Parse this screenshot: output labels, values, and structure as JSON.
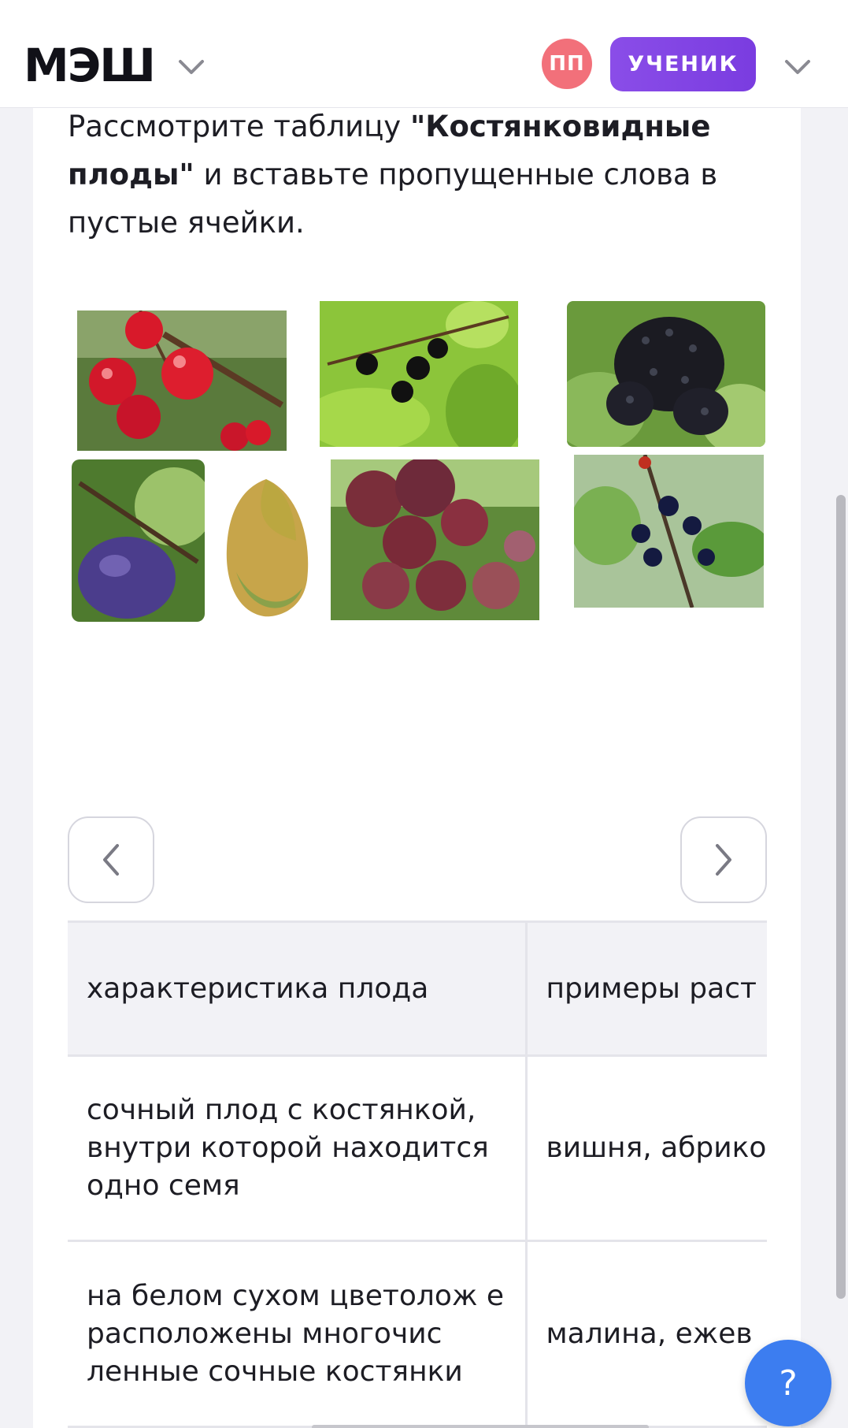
{
  "header": {
    "logo": "МЭШ",
    "avatar_initials": "ПП",
    "role_label": "УЧЕНИК"
  },
  "question": {
    "before": "Рассмотрите таблицу ",
    "bold": "\"Костянковидные плоды\"",
    "after": " и вставьте пропущенные слова в пустые ячейки."
  },
  "gallery": {
    "photos": [
      "cherry-photo",
      "bird-cherry-photo",
      "elderberry-photo",
      "plum-photo",
      "mango-photo",
      "cherry-plum-photo",
      "buckthorn-photo"
    ],
    "prev_icon": "chevron-left-icon",
    "next_icon": "chevron-right-icon"
  },
  "table": {
    "headers": [
      "характеристика плода",
      "примеры раст"
    ],
    "rows": [
      [
        "сочный плод с костянкой, внутри которой находится одно семя",
        "вишня, абрико"
      ],
      [
        "на белом сухом цветолож е расположены многочис ленные сочные костянки",
        "малина, ежев"
      ]
    ]
  },
  "help": {
    "label": "?"
  },
  "colors": {
    "accent": "#8a4de8",
    "avatar": "#f2707a",
    "help": "#3c7df0",
    "table_header_bg": "#f2f2f6"
  }
}
